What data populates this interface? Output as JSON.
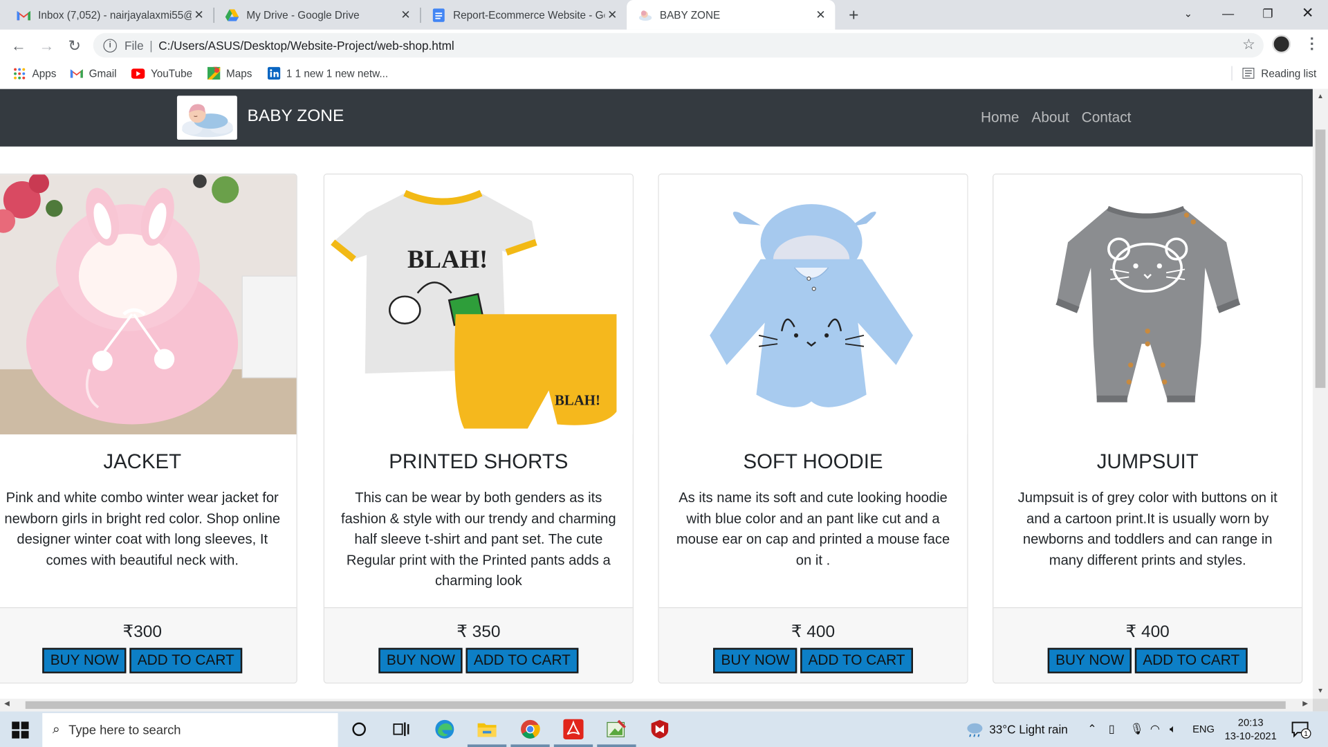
{
  "browser": {
    "tabs": [
      {
        "title": "Inbox (7,052) - nairjayalaxmi55@",
        "icon": "gmail-icon"
      },
      {
        "title": "My Drive - Google Drive",
        "icon": "google-drive-icon"
      },
      {
        "title": "Report-Ecommerce Website - Go",
        "icon": "google-docs-icon"
      },
      {
        "title": "BABY ZONE",
        "icon": "baby-favicon",
        "active": true
      }
    ],
    "address": {
      "scheme": "File",
      "url": "C:/Users/ASUS/Desktop/Website-Project/web-shop.html"
    },
    "bookmarks": [
      {
        "label": "Apps",
        "icon": "apps-grid-icon"
      },
      {
        "label": "Gmail",
        "icon": "gmail-icon"
      },
      {
        "label": "YouTube",
        "icon": "youtube-icon"
      },
      {
        "label": "Maps",
        "icon": "maps-icon"
      },
      {
        "label": "1 1 new 1 new netw...",
        "icon": "linkedin-icon"
      }
    ],
    "reading_list": "Reading list"
  },
  "site": {
    "brand": "BABY ZONE",
    "nav": [
      "Home",
      "About",
      "Contact"
    ],
    "products": [
      {
        "title": "JACKET",
        "text": "Pink and white combo winter wear jacket for newborn girls in bright red color. Shop online designer winter coat with long sleeves, It comes with beautiful neck with.",
        "price": "₹300",
        "buy": "BUY NOW",
        "cart": "ADD TO CART"
      },
      {
        "title": "PRINTED SHORTS",
        "text": "This can be wear by both genders as its fashion & style with our trendy and charming half sleeve t-shirt and pant set. The cute Regular print with the Printed pants adds a charming look",
        "price": "₹ 350",
        "buy": "BUY NOW",
        "cart": "ADD TO CART",
        "print_text": "BLAH!"
      },
      {
        "title": "SOFT HOODIE",
        "text": "As its name its soft and cute looking hoodie with blue color and an pant like cut and a mouse ear on cap and printed a mouse face on it .",
        "price": "₹ 400",
        "buy": "BUY NOW",
        "cart": "ADD TO CART"
      },
      {
        "title": "JUMPSUIT",
        "text": "Jumpsuit is of grey color with buttons on it and a cartoon print.It is usually worn by newborns and toddlers and can range in many different prints and styles.",
        "price": "₹ 400",
        "buy": "BUY NOW",
        "cart": "ADD TO CART"
      }
    ],
    "colors": {
      "navbar": "#343a40",
      "button": "#0d7fc6"
    }
  },
  "taskbar": {
    "search_placeholder": "Type here to search",
    "weather": "33°C  Light rain",
    "language": "ENG",
    "time": "20:13",
    "date": "13-10-2021",
    "notifications": "1"
  }
}
